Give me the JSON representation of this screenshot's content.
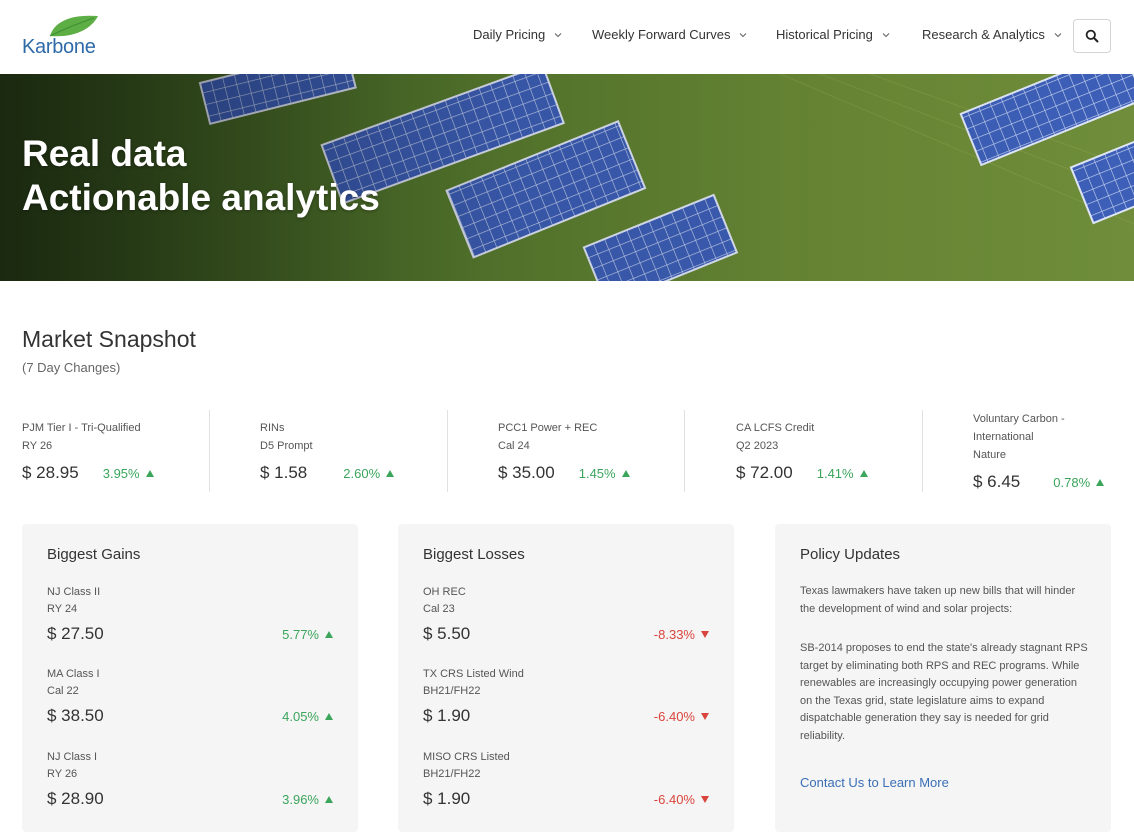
{
  "brand": {
    "name": "Karbone",
    "leaf_color": "#5cae45",
    "text_color": "#2e6aa8"
  },
  "nav": {
    "items": [
      {
        "label": "Daily Pricing"
      },
      {
        "label": "Weekly Forward Curves"
      },
      {
        "label": "Historical Pricing"
      },
      {
        "label": "Research & Analytics"
      }
    ],
    "search_icon": "search-icon"
  },
  "hero": {
    "line1": "Real data",
    "line2": "Actionable analytics"
  },
  "snapshot": {
    "title": "Market Snapshot",
    "subtitle": "(7 Day Changes)",
    "tickers": [
      {
        "name1": "PJM Tier I - Tri-Qualified",
        "name2": "RY 26",
        "name3": "",
        "price": "$ 28.95",
        "change": "3.95%"
      },
      {
        "name1": "RINs",
        "name2": "D5 Prompt",
        "name3": "",
        "price": "$ 1.58",
        "change": "2.60%"
      },
      {
        "name1": "PCC1 Power + REC",
        "name2": "Cal 24",
        "name3": "",
        "price": "$ 35.00",
        "change": "1.45%"
      },
      {
        "name1": "CA LCFS Credit",
        "name2": "Q2 2023",
        "name3": "",
        "price": "$ 72.00",
        "change": "1.41%"
      },
      {
        "name1": "Voluntary Carbon -",
        "name2": "International",
        "name3": "Nature",
        "price": "$ 6.45",
        "change": "0.78%"
      }
    ]
  },
  "gains": {
    "title": "Biggest Gains",
    "items": [
      {
        "name1": "NJ Class II",
        "name2": "RY 24",
        "price": "$ 27.50",
        "change": "5.77%"
      },
      {
        "name1": "MA Class I",
        "name2": "Cal 22",
        "price": "$ 38.50",
        "change": "4.05%"
      },
      {
        "name1": "NJ Class I",
        "name2": "RY 26",
        "price": "$ 28.90",
        "change": "3.96%"
      }
    ]
  },
  "losses": {
    "title": "Biggest Losses",
    "items": [
      {
        "name1": "OH REC",
        "name2": "Cal 23",
        "price": "$ 5.50",
        "change": "-8.33%"
      },
      {
        "name1": "TX CRS Listed Wind",
        "name2": "BH21/FH22",
        "price": "$ 1.90",
        "change": "-6.40%"
      },
      {
        "name1": "MISO CRS Listed",
        "name2": "BH21/FH22",
        "price": "$ 1.90",
        "change": "-6.40%"
      }
    ]
  },
  "policy": {
    "title": "Policy Updates",
    "p1": "Texas lawmakers have taken up new bills that will hinder the development of wind and solar projects:",
    "p2": "SB-2014 proposes to end the state's already stagnant RPS target by eliminating both RPS and REC programs. While renewables are increasingly occupying power generation on the Texas grid, state legislature aims to expand dispatchable generation they say is needed for grid reliability.",
    "link": "Contact Us to Learn More"
  },
  "colors": {
    "positive": "#3aa55b",
    "negative": "#d9453c",
    "link": "#3b6fb6",
    "card_bg": "#f5f5f5"
  }
}
